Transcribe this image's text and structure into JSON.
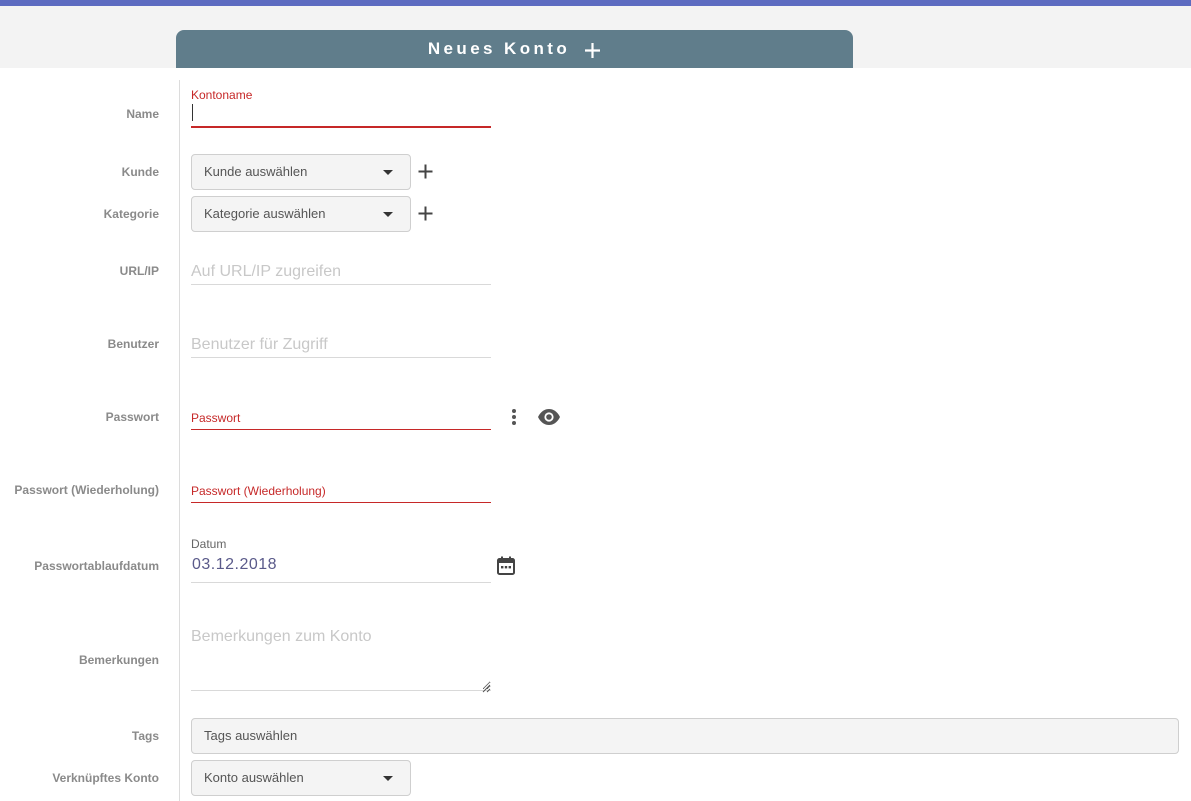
{
  "tab": {
    "title": "Neues Konto"
  },
  "labels": {
    "name": "Name",
    "kunde": "Kunde",
    "kategorie": "Kategorie",
    "url": "URL/IP",
    "benutzer": "Benutzer",
    "passwort": "Passwort",
    "passwort_wdh": "Passwort (Wiederholung)",
    "ablaufdatum": "Passwortablaufdatum",
    "bemerkungen": "Bemerkungen",
    "tags": "Tags",
    "verknuepft": "Verknüpftes Konto"
  },
  "fields": {
    "kontoname": {
      "label": "Kontoname",
      "value": ""
    },
    "kunde_select": {
      "value": "Kunde auswählen"
    },
    "kategorie_select": {
      "value": "Kategorie auswählen"
    },
    "url": {
      "placeholder": "Auf URL/IP zugreifen"
    },
    "benutzer": {
      "placeholder": "Benutzer für Zugriff"
    },
    "passwort": {
      "label": "Passwort"
    },
    "passwort_wdh": {
      "label": "Passwort (Wiederholung)"
    },
    "datum": {
      "label": "Datum",
      "value": "03.12.2018"
    },
    "bemerkungen": {
      "placeholder": "Bemerkungen zum Konto"
    },
    "tags_select": {
      "value": "Tags auswählen"
    },
    "konto_select": {
      "value": "Konto auswählen"
    }
  },
  "icons": {
    "tab": "plus-icon",
    "add": "plus-icon",
    "more": "more-vertical-icon",
    "visibility": "eye-icon",
    "calendar": "calendar-icon",
    "dropdown": "chevron-down-icon"
  },
  "colors": {
    "accent": "#5c6bc0",
    "tab_bg": "#607d8b",
    "error": "#c62828"
  }
}
